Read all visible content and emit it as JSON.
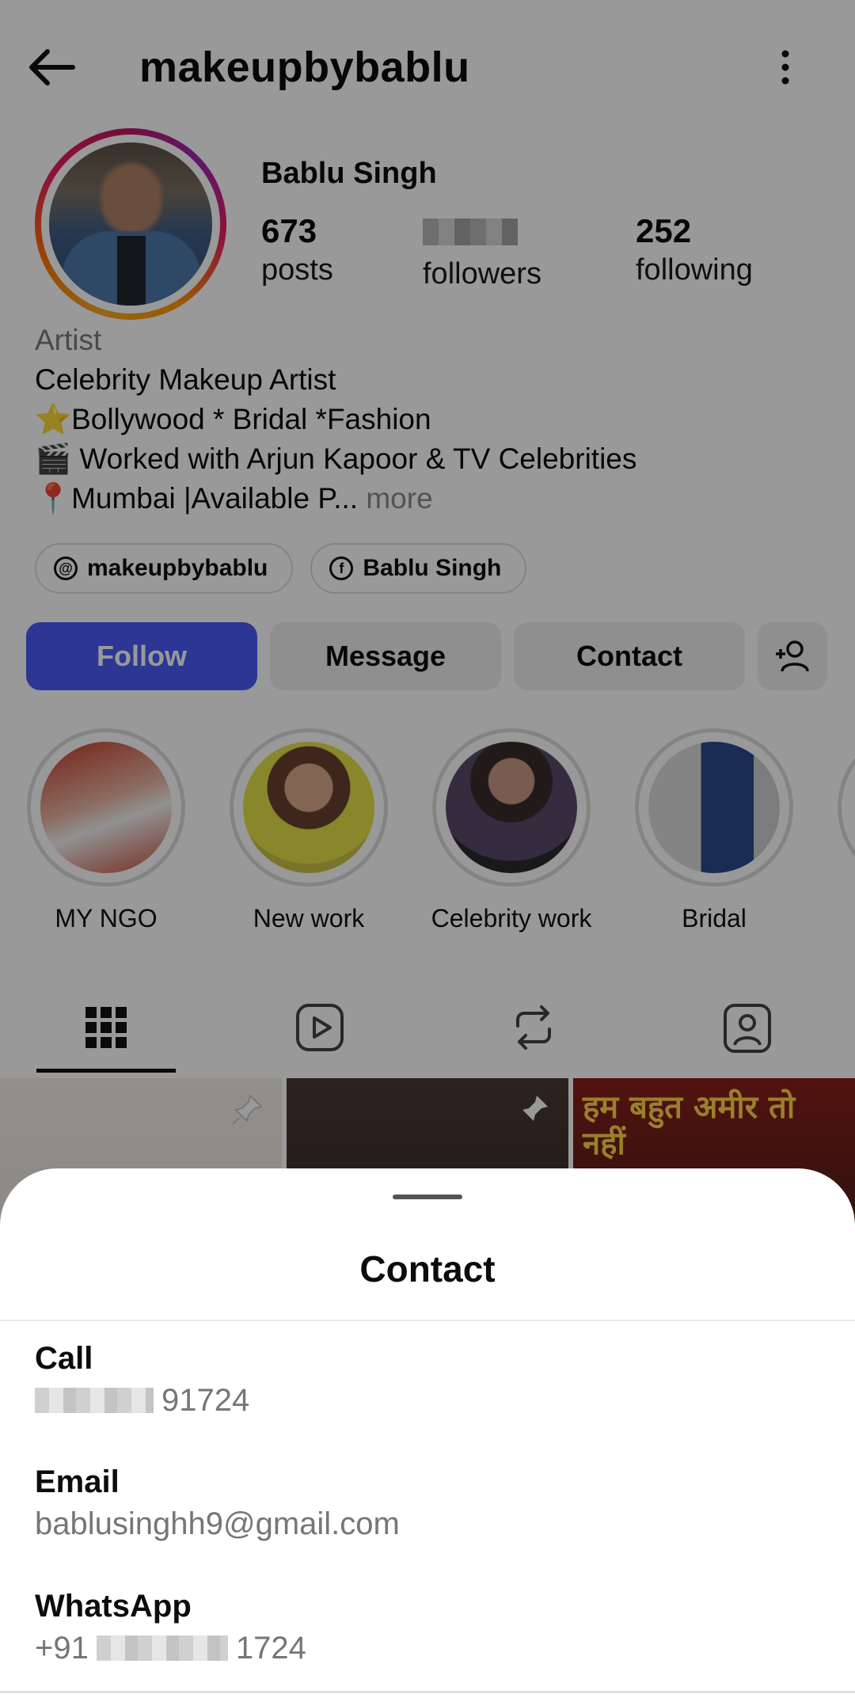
{
  "header": {
    "username": "makeupbybablu",
    "icons": {
      "back": "back-arrow-icon",
      "menu": "more-vertical-icon"
    }
  },
  "profile": {
    "display_name": "Bablu Singh",
    "stats": {
      "posts_count": "673",
      "posts_label": "posts",
      "followers_label": "followers",
      "following_count": "252",
      "following_label": "following"
    },
    "bio": {
      "category": "Artist",
      "line1": "Celebrity Makeup Artist",
      "line2": "⭐Bollywood * Bridal *Fashion",
      "line3": "🎬 Worked with Arjun Kapoor & TV Celebrities",
      "line4": "📍Mumbai |Available P...",
      "more": " more"
    },
    "links": [
      {
        "label": "makeupbybablu",
        "icon": "threads-icon"
      },
      {
        "label": "Bablu Singh",
        "icon": "facebook-icon"
      }
    ]
  },
  "actions": {
    "follow": "Follow",
    "message": "Message",
    "contact": "Contact",
    "suggest_icon": "add-person-icon"
  },
  "highlights": [
    {
      "label": "MY NGO"
    },
    {
      "label": "New work"
    },
    {
      "label": "Celebrity work"
    },
    {
      "label": "Bridal"
    }
  ],
  "tabs": [
    {
      "icon": "grid-icon",
      "active": true
    },
    {
      "icon": "reels-icon",
      "active": false
    },
    {
      "icon": "reposts-icon",
      "active": false
    },
    {
      "icon": "tagged-icon",
      "active": false
    }
  ],
  "grid_posts": [
    {
      "text": ""
    },
    {
      "text": ""
    },
    {
      "text": "हम बहुत अमीर तो नहीं"
    }
  ],
  "sheet": {
    "title": "Contact",
    "call_label": "Call",
    "call_value_suffix": " 91724",
    "email_label": "Email",
    "email_value": "bablusinghh9@gmail.com",
    "whatsapp_label": "WhatsApp",
    "whatsapp_prefix": "+91",
    "whatsapp_suffix": "1724"
  },
  "colors": {
    "follow_button": "#4a5df9",
    "secondary_button": "#efefef",
    "scrim": "rgba(0,0,0,0.40)"
  }
}
